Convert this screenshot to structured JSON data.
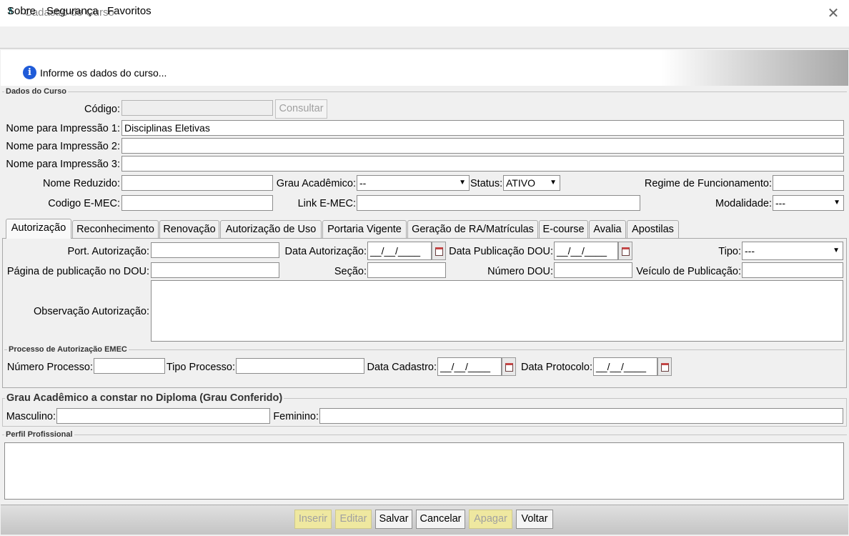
{
  "window": {
    "title": "Cadastro de Curso",
    "logo": "/\\",
    "close": "✕"
  },
  "menu": {
    "items": [
      {
        "label": "Sobre"
      },
      {
        "label": "Segurança"
      },
      {
        "label": "Favoritos"
      }
    ]
  },
  "info": {
    "icon": "i",
    "text": "Informe os dados do curso..."
  },
  "dados": {
    "group_title": "Dados do Curso",
    "codigo_label": "Código:",
    "codigo_value": "",
    "consultar_label": "Consultar",
    "nome1_label": "Nome para Impressão 1:",
    "nome1_value": "Disciplinas Eletivas",
    "nome2_label": "Nome para Impressão 2:",
    "nome2_value": "",
    "nome3_label": "Nome para Impressão 3:",
    "nome3_value": "",
    "nome_reduzido_label": "Nome Reduzido:",
    "nome_reduzido_value": "",
    "grau_label": "Grau Acadêmico:",
    "grau_value": "--",
    "status_label": "Status:",
    "status_value": "ATIVO",
    "regime_label": "Regime de Funcionamento:",
    "regime_value": "",
    "emec_label": "Codigo E-MEC:",
    "emec_value": "",
    "link_label": "Link E-MEC:",
    "link_value": "",
    "modalidade_label": "Modalidade:",
    "modalidade_value": "---"
  },
  "tabs": [
    {
      "label": "Autorização"
    },
    {
      "label": "Reconhecimento"
    },
    {
      "label": "Renovação"
    },
    {
      "label": "Autorização de Uso"
    },
    {
      "label": "Portaria Vigente"
    },
    {
      "label": "Geração de RA/Matrículas"
    },
    {
      "label": "E-course"
    },
    {
      "label": "Avalia"
    },
    {
      "label": "Apostilas"
    }
  ],
  "autorizacao": {
    "port_label": "Port. Autorização:",
    "port_value": "",
    "data_aut_label": "Data Autorização:",
    "data_aut_value": "__/__/____",
    "data_pub_label": "Data Publicação DOU:",
    "data_pub_value": "__/__/____",
    "tipo_label": "Tipo:",
    "tipo_value": "---",
    "pagina_label": "Página de publicação no DOU:",
    "pagina_value": "",
    "secao_label": "Seção:",
    "secao_value": "",
    "numero_dou_label": "Número DOU:",
    "numero_dou_value": "",
    "veiculo_label": "Veículo de Publicação:",
    "veiculo_value": "",
    "obs_label": "Observação Autorização:",
    "obs_value": "",
    "emec_group_title": "Processo de Autorização EMEC",
    "num_proc_label": "Número Processo:",
    "num_proc_value": "",
    "tipo_proc_label": "Tipo Processo:",
    "tipo_proc_value": "",
    "data_cad_label": "Data Cadastro:",
    "data_cad_value": "__/__/____",
    "data_prot_label": "Data Protocolo:",
    "data_prot_value": "__/__/____"
  },
  "grau_diploma": {
    "title": "Grau Acadêmico a constar no Diploma (Grau Conferido)",
    "masc_label": "Masculino:",
    "masc_value": "",
    "fem_label": "Feminino:",
    "fem_value": ""
  },
  "perfil": {
    "title": "Perfil Profissional",
    "value": ""
  },
  "buttons": {
    "inserir": "Inserir",
    "editar": "Editar",
    "salvar": "Salvar",
    "cancelar": "Cancelar",
    "apagar": "Apagar",
    "voltar": "Voltar"
  },
  "colors": {
    "info_icon": "#1f5bd8",
    "disabled_button_bg": "#efe8a0",
    "logo": "#1b6e72"
  }
}
